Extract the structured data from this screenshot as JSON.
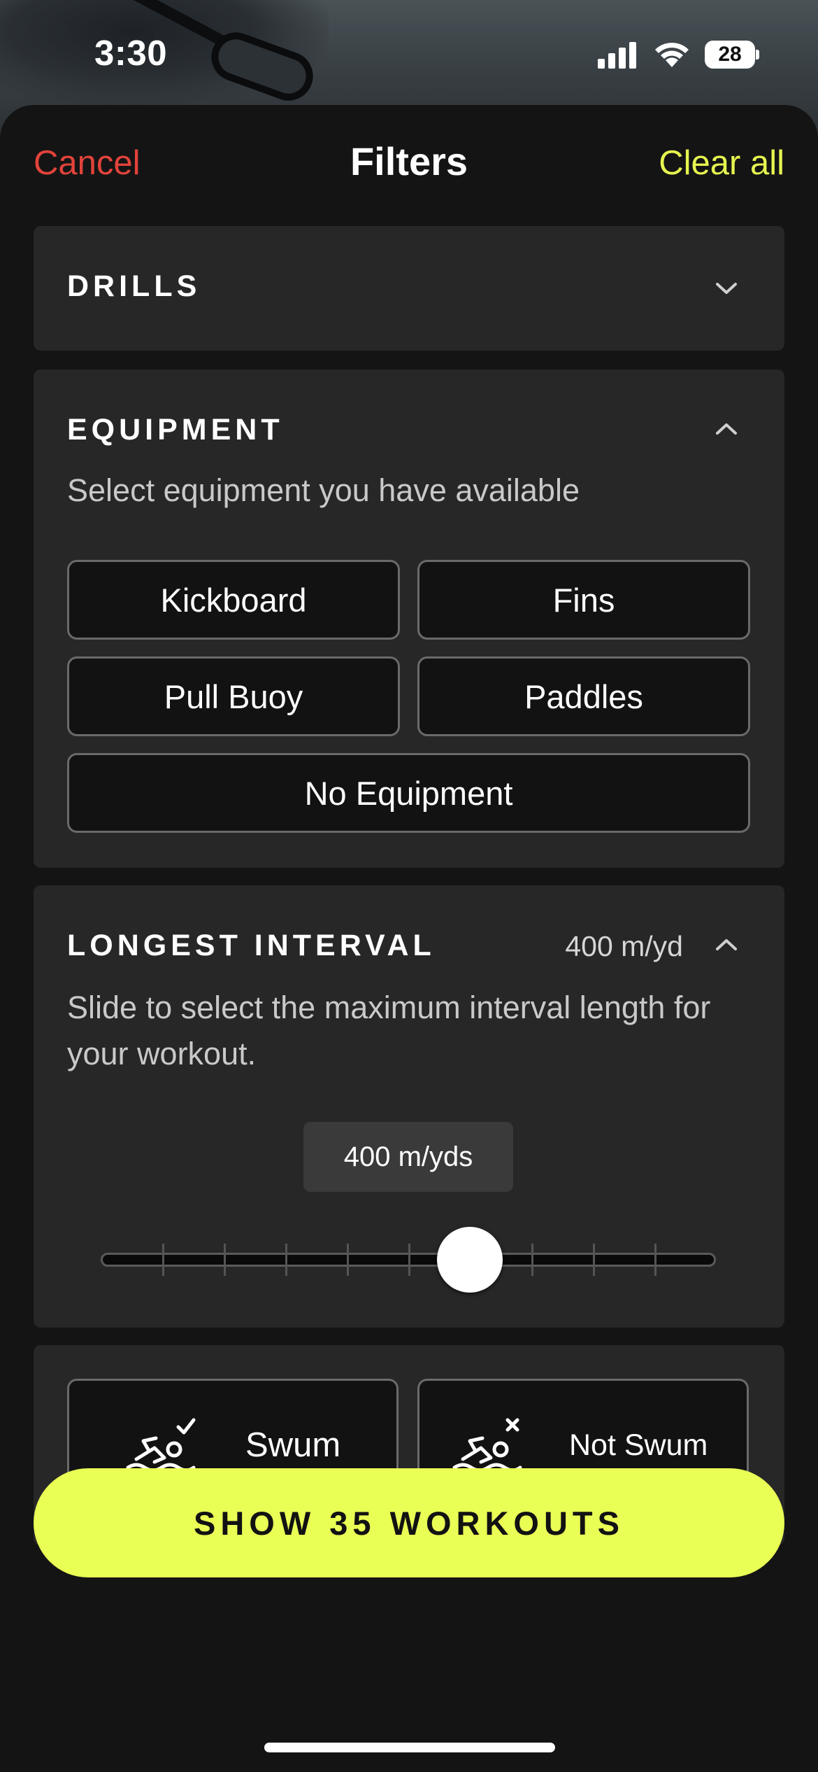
{
  "status_bar": {
    "time": "3:30",
    "battery": "28"
  },
  "nav": {
    "cancel_label": "Cancel",
    "title": "Filters",
    "clear_all_label": "Clear all"
  },
  "sections": {
    "drills": {
      "title": "DRILLS",
      "expanded": false
    },
    "equipment": {
      "title": "EQUIPMENT",
      "expanded": true,
      "description": "Select equipment you have available",
      "options": [
        "Kickboard",
        "Fins",
        "Pull Buoy",
        "Paddles",
        "No Equipment"
      ]
    },
    "longest_interval": {
      "title": "LONGEST INTERVAL",
      "expanded": true,
      "summary_value": "400 m/yd",
      "description": "Slide to select the maximum interval length for your workout.",
      "current_value": "400 m/yds",
      "slider_position_fraction": 0.6
    },
    "swum_status": {
      "swum_label": "Swum",
      "not_swum_label": "Not Swum"
    }
  },
  "cta": {
    "label": "SHOW 35 WORKOUTS"
  },
  "colors": {
    "cancel": "#e2433b",
    "accent": "#e6f54f",
    "cta_background": "#eaff55",
    "card_background": "#272727",
    "sheet_background": "#141414"
  },
  "icons": {
    "signal": "cellular-signal-icon",
    "wifi": "wifi-icon",
    "battery": "battery-icon",
    "swum": "swimmer-check-icon",
    "not_swum": "swimmer-x-icon",
    "collapse": "chevron-up-icon",
    "expand": "chevron-down-icon"
  }
}
